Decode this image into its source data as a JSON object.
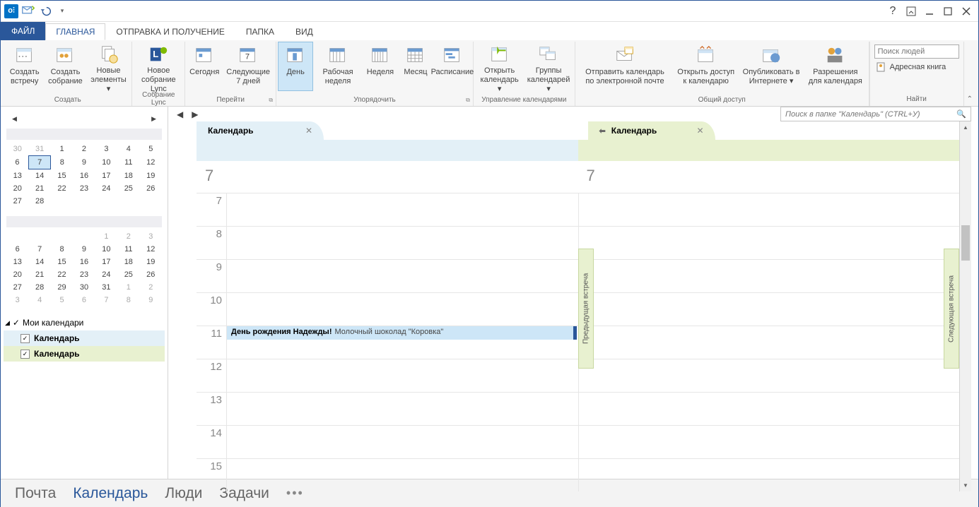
{
  "titlebar": {
    "help_tip": "Справка",
    "ribbon_opts": "Параметры ленты",
    "minimize": "Свернуть",
    "maximize": "Развернуть",
    "close": "Закрыть"
  },
  "tabs": {
    "file": "ФАЙЛ",
    "home": "ГЛАВНАЯ",
    "sendrecv": "ОТПРАВКА И ПОЛУЧЕНИЕ",
    "folder": "ПАПКА",
    "view": "ВИД"
  },
  "ribbon": {
    "create": {
      "label": "Создать",
      "new_appt": "Создать встречу",
      "new_meeting": "Создать собрание",
      "new_items": "Новые элементы"
    },
    "lync": {
      "label": "Собрание Lync",
      "new_lync": "Новое собрание Lync"
    },
    "goto": {
      "label": "Перейти",
      "today": "Сегодня",
      "next7": "Следующие 7 дней"
    },
    "arrange": {
      "label": "Упорядочить",
      "day": "День",
      "workweek": "Рабочая неделя",
      "week": "Неделя",
      "month": "Месяц",
      "schedule": "Расписание"
    },
    "manage": {
      "label": "Управление календарями",
      "open_cal": "Открыть календарь",
      "cal_groups": "Группы календарей"
    },
    "share": {
      "label": "Общий доступ",
      "email_cal": "Отправить календарь по электронной почте",
      "share_cal": "Открыть доступ к календарю",
      "publish": "Опубликовать в Интернете",
      "perms": "Разрешения для календаря"
    },
    "find": {
      "label": "Найти",
      "search_ppl_ph": "Поиск людей",
      "addr_book": "Адресная книга"
    }
  },
  "minical1": {
    "weeks": [
      [
        "30",
        "31",
        "1",
        "2",
        "3",
        "4",
        "5"
      ],
      [
        "6",
        "7",
        "8",
        "9",
        "10",
        "11",
        "12"
      ],
      [
        "13",
        "14",
        "15",
        "16",
        "17",
        "18",
        "19"
      ],
      [
        "20",
        "21",
        "22",
        "23",
        "24",
        "25",
        "26"
      ],
      [
        "27",
        "28",
        "",
        "",
        "",
        "",
        ""
      ]
    ],
    "today": "7",
    "other_month": [
      "30",
      "31"
    ]
  },
  "minical2": {
    "weeks": [
      [
        "",
        "",
        "",
        "",
        "1",
        "2",
        "3"
      ],
      [
        "6",
        "7",
        "8",
        "9",
        "10",
        "11",
        "12"
      ],
      [
        "13",
        "14",
        "15",
        "16",
        "17",
        "18",
        "19"
      ],
      [
        "20",
        "21",
        "22",
        "23",
        "24",
        "25",
        "26"
      ],
      [
        "27",
        "28",
        "29",
        "30",
        "31",
        "1",
        "2"
      ],
      [
        "3",
        "4",
        "5",
        "6",
        "7",
        "8",
        "9"
      ]
    ],
    "other_month": [
      "1",
      "2",
      "3",
      "4",
      "5",
      "6",
      "7",
      "8",
      "9"
    ]
  },
  "cal_list": {
    "group": "Мои календари",
    "items": [
      {
        "label": "Календарь",
        "color": "blue"
      },
      {
        "label": "Календарь",
        "color": "green"
      }
    ]
  },
  "content": {
    "search_ph": "Поиск в папке \"Календарь\" (CTRL+У)",
    "tabs": [
      {
        "label": "Календарь",
        "color": "blue"
      },
      {
        "label": "Календарь",
        "color": "green"
      }
    ],
    "day_number": "7",
    "hours": [
      "7",
      "8",
      "9",
      "10",
      "11",
      "12",
      "13",
      "14",
      "15"
    ],
    "event": {
      "hour": "11",
      "title": "День рождения Надежды!",
      "location": "Молочный шоколад \"Коровка\""
    },
    "prev_meeting": "Предыдущая встреча",
    "next_meeting": "Следующая встреча"
  },
  "bottom": {
    "mail": "Почта",
    "calendar": "Календарь",
    "people": "Люди",
    "tasks": "Задачи"
  }
}
